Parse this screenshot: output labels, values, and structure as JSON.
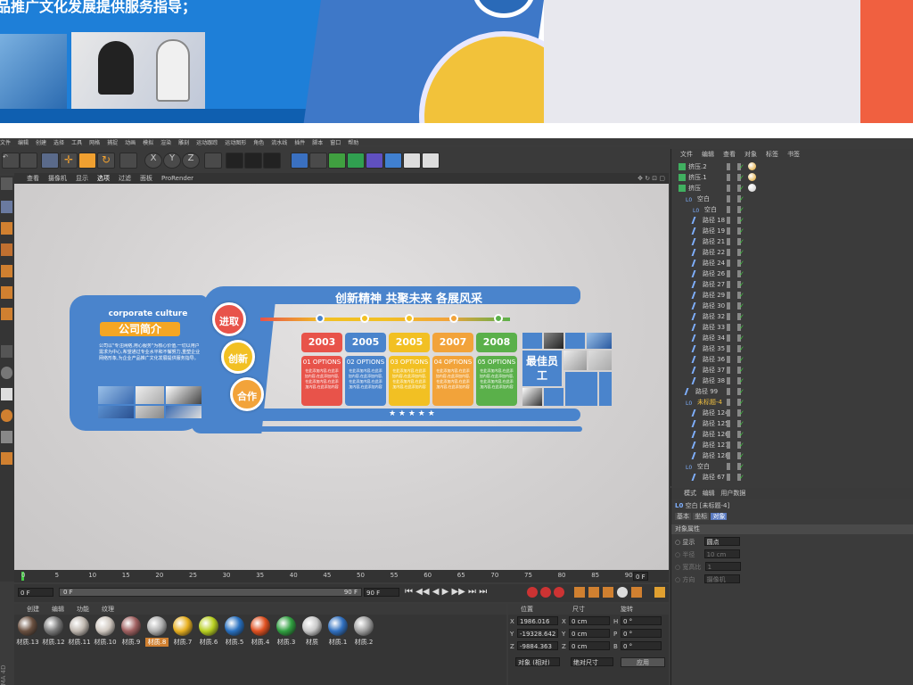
{
  "banner": {
    "heading": "品推广文化发展提供服务指导；"
  },
  "menu": [
    "文件",
    "编辑",
    "创建",
    "选择",
    "工具",
    "网格",
    "捕捉",
    "动画",
    "模拟",
    "渲染",
    "雕刻",
    "运动跟踪",
    "运动图形",
    "角色",
    "流水线",
    "插件",
    "脚本",
    "窗口",
    "帮助"
  ],
  "viewport_menu": [
    "查看",
    "摄像机",
    "显示",
    "选项",
    "过滤",
    "面板",
    "ProRender"
  ],
  "design": {
    "title": "创新精神 共聚未来 各展风采",
    "corporate": "corporate culture",
    "company": "公司简介",
    "intro": "公司以\"专注网络,用心服务\"为核心价值,一切以用户需求为中心,希望通过专业水平和不懈努力,重塑企业网络形象,为企业产品推广文化发展提供服务指导。",
    "circles": [
      "进取",
      "创新",
      "合作"
    ],
    "years": [
      "2003",
      "2005",
      "2005",
      "2007",
      "2008"
    ],
    "options": [
      "01 OPTIONS",
      "02 OPTIONS",
      "03 OPTIONS",
      "04 OPTIONS",
      "05 OPTIONS"
    ],
    "option_text": "在此添加内容,在此添加内容,在此添加内容,在此添加内容,在此添加内容,在此添加内容",
    "best": "最佳员工",
    "stars": "★ ★ ★ ★ ★"
  },
  "timeline": {
    "ticks": [
      "0",
      "5",
      "10",
      "15",
      "20",
      "25",
      "30",
      "35",
      "40",
      "45",
      "50",
      "55",
      "60",
      "65",
      "70",
      "75",
      "80",
      "85",
      "90"
    ],
    "start": "0 F",
    "start2": "0 F",
    "end": "90 F",
    "end2": "90 F",
    "current": "0 F"
  },
  "material_tabs": [
    "创建",
    "编辑",
    "功能",
    "纹理"
  ],
  "materials": [
    {
      "name": "材质.13",
      "color": "#6a5040"
    },
    {
      "name": "材质.12",
      "color": "#7a7a7a"
    },
    {
      "name": "材质.11",
      "color": "#c0b8b0"
    },
    {
      "name": "材质.10",
      "color": "#d0c8c0"
    },
    {
      "name": "材质.9",
      "color": "#a06060"
    },
    {
      "name": "材质.8",
      "color": "#b0b0b0"
    },
    {
      "name": "材质.7",
      "color": "#e8b020"
    },
    {
      "name": "材质.6",
      "color": "#b8d020"
    },
    {
      "name": "材质.5",
      "color": "#2870c0"
    },
    {
      "name": "材质.4",
      "color": "#e05020"
    },
    {
      "name": "材质.3",
      "color": "#30a040"
    },
    {
      "name": "材质",
      "color": "#c8c8c8"
    },
    {
      "name": "材质.1",
      "color": "#3070c0"
    },
    {
      "name": "材质.2",
      "color": "#a0a0a0"
    }
  ],
  "coords": {
    "headers": [
      "位置",
      "尺寸",
      "旋转"
    ],
    "x": "1986.016 cm",
    "y": "-19328.642 cm",
    "z": "-9884.363 cm",
    "sx": "0 cm",
    "sy": "0 cm",
    "sz": "0 cm",
    "h": "0 °",
    "p": "0 °",
    "b": "0 °",
    "mode1": "对象 (相对)",
    "mode2": "绝对尺寸",
    "apply": "应用"
  },
  "obj_tabs": [
    "文件",
    "编辑",
    "查看",
    "对象",
    "标签",
    "书签"
  ],
  "objects": [
    {
      "name": "挤压.2",
      "indent": 0
    },
    {
      "name": "挤压.1",
      "indent": 0
    },
    {
      "name": "挤压",
      "indent": 0
    },
    {
      "name": "空白",
      "indent": 1
    },
    {
      "name": "空白",
      "indent": 2
    },
    {
      "name": "路径 18",
      "indent": 2
    },
    {
      "name": "路径 19",
      "indent": 2
    },
    {
      "name": "路径 21",
      "indent": 2
    },
    {
      "name": "路径 22",
      "indent": 2
    },
    {
      "name": "路径 24",
      "indent": 2
    },
    {
      "name": "路径 26",
      "indent": 2
    },
    {
      "name": "路径 27",
      "indent": 2
    },
    {
      "name": "路径 29",
      "indent": 2
    },
    {
      "name": "路径 30",
      "indent": 2
    },
    {
      "name": "路径 32",
      "indent": 2
    },
    {
      "name": "路径 33",
      "indent": 2
    },
    {
      "name": "路径 34",
      "indent": 2
    },
    {
      "name": "路径 35",
      "indent": 2
    },
    {
      "name": "路径 36",
      "indent": 2
    },
    {
      "name": "路径 37",
      "indent": 2
    },
    {
      "name": "路径 38",
      "indent": 2
    },
    {
      "name": "路径 99",
      "indent": 1
    },
    {
      "name": "未标题-4",
      "indent": 1
    },
    {
      "name": "路径 124",
      "indent": 2
    },
    {
      "name": "路径 125",
      "indent": 2
    },
    {
      "name": "路径 126",
      "indent": 2
    },
    {
      "name": "路径 127",
      "indent": 2
    },
    {
      "name": "路径 128",
      "indent": 2
    },
    {
      "name": "空白",
      "indent": 1
    },
    {
      "name": "路径 67",
      "indent": 2
    }
  ],
  "attr": {
    "tabs": [
      "模式",
      "编辑",
      "用户数据"
    ],
    "title": "空白 [未标题-4]",
    "subtabs": [
      "基本",
      "坐标",
      "对象"
    ],
    "section": "对象属性",
    "display_label": "显示",
    "display_value": "圆点",
    "radius_label": "半径",
    "radius_value": "10 cm",
    "ratio_label": "宽高比",
    "ratio_value": "1",
    "dir_label": "方向",
    "dir_value": "摄像机"
  },
  "side_label": "CINEMA 4D"
}
